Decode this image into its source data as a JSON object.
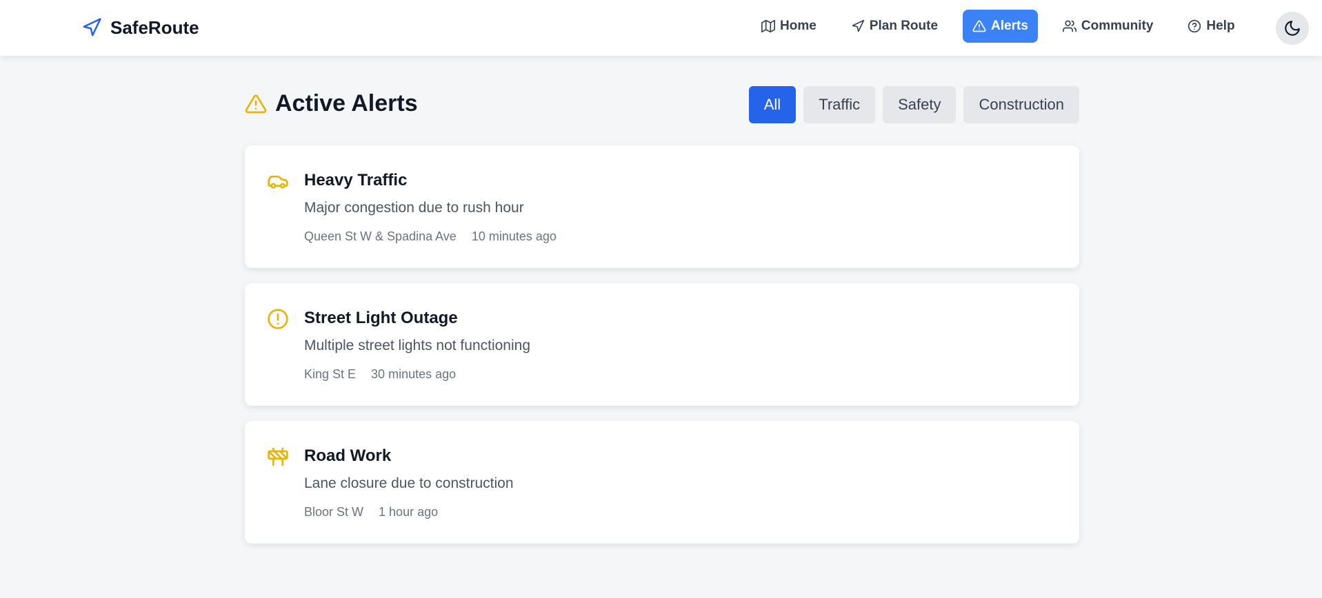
{
  "brand": {
    "name": "SafeRoute",
    "accent": "#2563eb"
  },
  "nav": {
    "items": [
      {
        "label": "Home",
        "icon": "map-icon"
      },
      {
        "label": "Plan Route",
        "icon": "navigation-icon"
      },
      {
        "label": "Alerts",
        "icon": "alert-triangle-icon",
        "active": true
      },
      {
        "label": "Community",
        "icon": "users-icon"
      },
      {
        "label": "Help",
        "icon": "help-circle-icon"
      }
    ],
    "theme_toggle_icon": "moon-icon"
  },
  "page": {
    "title": "Active Alerts",
    "title_icon": "alert-triangle-icon",
    "filters": [
      {
        "label": "All",
        "active": true
      },
      {
        "label": "Traffic"
      },
      {
        "label": "Safety"
      },
      {
        "label": "Construction"
      }
    ]
  },
  "alerts": [
    {
      "icon": "car-icon",
      "title": "Heavy Traffic",
      "description": "Major congestion due to rush hour",
      "location": "Queen St W & Spadina Ave",
      "time": "10 minutes ago"
    },
    {
      "icon": "alert-circle-icon",
      "title": "Street Light Outage",
      "description": "Multiple street lights not functioning",
      "location": "King St E",
      "time": "30 minutes ago"
    },
    {
      "icon": "construction-icon",
      "title": "Road Work",
      "description": "Lane closure due to construction",
      "location": "Bloor St W",
      "time": "1 hour ago"
    }
  ],
  "colors": {
    "alert_icon": "#eab308",
    "active_nav": "#3b82f6",
    "active_filter": "#2563eb",
    "background": "#f5f6f8"
  }
}
